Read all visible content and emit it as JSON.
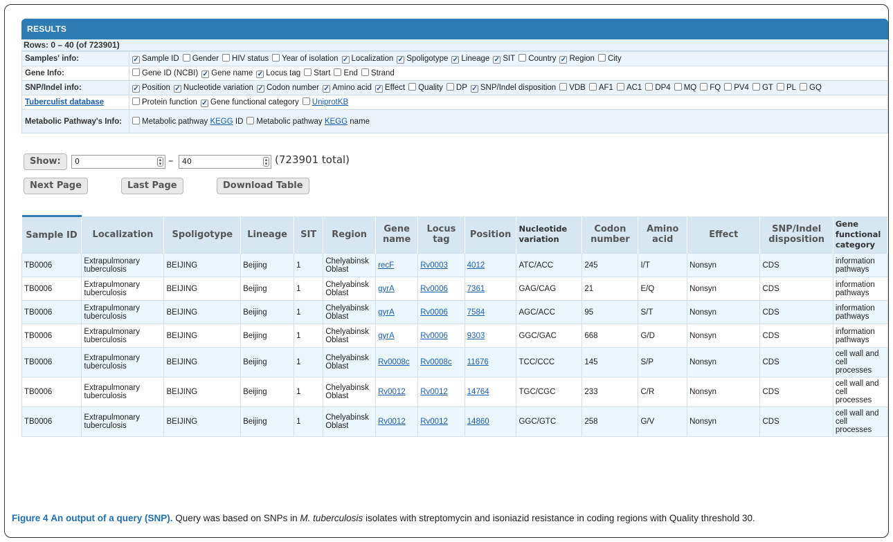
{
  "results_title": "RESULTS",
  "rows_info": "Rows: 0 – 40 (of 723901)",
  "info_rows": [
    {
      "label": "Samples' info:",
      "options": [
        {
          "text": "Sample ID",
          "checked": true
        },
        {
          "text": "Gender",
          "checked": false
        },
        {
          "text": "HIV status",
          "checked": false
        },
        {
          "text": "Year of isolation",
          "checked": false
        },
        {
          "text": "Localization",
          "checked": true
        },
        {
          "text": "Spoligotype",
          "checked": true
        },
        {
          "text": "Lineage",
          "checked": true
        },
        {
          "text": "SIT",
          "checked": true
        },
        {
          "text": "Country",
          "checked": false
        },
        {
          "text": "Region",
          "checked": true
        },
        {
          "text": "City",
          "checked": false
        }
      ]
    },
    {
      "label": "Gene Info:",
      "options": [
        {
          "text": "Gene ID (NCBI)",
          "checked": false
        },
        {
          "text": "Gene name",
          "checked": true
        },
        {
          "text": "Locus tag",
          "checked": true
        },
        {
          "text": "Start",
          "checked": false
        },
        {
          "text": "End",
          "checked": false
        },
        {
          "text": "Strand",
          "checked": false
        }
      ]
    },
    {
      "label": "SNP/Indel info:",
      "options": [
        {
          "text": "Position",
          "checked": true
        },
        {
          "text": "Nucleotide variation",
          "checked": true
        },
        {
          "text": "Codon number",
          "checked": true
        },
        {
          "text": "Amino acid",
          "checked": true
        },
        {
          "text": "Effect",
          "checked": true
        },
        {
          "text": "Quality",
          "checked": false
        },
        {
          "text": "DP",
          "checked": false
        },
        {
          "text": "SNP/Indel disposition",
          "checked": true
        },
        {
          "text": "VDB",
          "checked": false
        },
        {
          "text": "AF1",
          "checked": false
        },
        {
          "text": "AC1",
          "checked": false
        },
        {
          "text": "DP4",
          "checked": false
        },
        {
          "text": "MQ",
          "checked": false
        },
        {
          "text": "FQ",
          "checked": false
        },
        {
          "text": "PV4",
          "checked": false
        },
        {
          "text": "GT",
          "checked": false
        },
        {
          "text": "PL",
          "checked": false
        },
        {
          "text": "GQ",
          "checked": false
        }
      ]
    },
    {
      "label": "Tuberculist database",
      "label_link": true,
      "options": [
        {
          "text": "Protein function",
          "checked": false
        },
        {
          "text": "Gene functional category",
          "checked": true
        },
        {
          "text": "UniprotKB",
          "checked": false,
          "link": true
        }
      ]
    },
    {
      "label": "Metabolic Pathway's Info:",
      "options": [
        {
          "text": "Metabolic pathway",
          "link_text": "KEGG",
          "suffix": "ID",
          "checked": false
        },
        {
          "text": "Metabolic pathway",
          "link_text": "KEGG",
          "suffix": "name",
          "checked": false
        }
      ]
    }
  ],
  "controls": {
    "show_label": "Show:",
    "from_value": "0",
    "dash": "–",
    "to_value": "40",
    "total_text": "(723901 total)",
    "next_page": "Next Page",
    "last_page": "Last Page",
    "download_table": "Download Table"
  },
  "table": {
    "headers": [
      "Sample ID",
      "Localization",
      "Spoligotype",
      "Lineage",
      "SIT",
      "Region",
      "Gene name",
      "Locus tag",
      "Position",
      "Nucleotide variation",
      "Codon number",
      "Amino acid",
      "Effect",
      "SNP/Indel disposition",
      "Gene functional category"
    ],
    "rows": [
      [
        "TB0006",
        "Extrapulmonary tuberculosis",
        "BEIJING",
        "Beijing",
        "1",
        "Chelyabinsk Oblast",
        "recF",
        "Rv0003",
        "4012",
        "ATC/ACC",
        "245",
        "I/T",
        "Nonsyn",
        "CDS",
        "information pathways"
      ],
      [
        "TB0006",
        "Extrapulmonary tuberculosis",
        "BEIJING",
        "Beijing",
        "1",
        "Chelyabinsk Oblast",
        "gyrA",
        "Rv0006",
        "7361",
        "GAG/CAG",
        "21",
        "E/Q",
        "Nonsyn",
        "CDS",
        "information pathways"
      ],
      [
        "TB0006",
        "Extrapulmonary tuberculosis",
        "BEIJING",
        "Beijing",
        "1",
        "Chelyabinsk Oblast",
        "gyrA",
        "Rv0006",
        "7584",
        "AGC/ACC",
        "95",
        "S/T",
        "Nonsyn",
        "CDS",
        "information pathways"
      ],
      [
        "TB0006",
        "Extrapulmonary tuberculosis",
        "BEIJING",
        "Beijing",
        "1",
        "Chelyabinsk Oblast",
        "gyrA",
        "Rv0006",
        "9303",
        "GGC/GAC",
        "668",
        "G/D",
        "Nonsyn",
        "CDS",
        "information pathways"
      ],
      [
        "TB0006",
        "Extrapulmonary tuberculosis",
        "BEIJING",
        "Beijing",
        "1",
        "Chelyabinsk Oblast",
        "Rv0008c",
        "Rv0008c",
        "11676",
        "TCC/CCC",
        "145",
        "S/P",
        "Nonsyn",
        "CDS",
        "cell wall and cell processes"
      ],
      [
        "TB0006",
        "Extrapulmonary tuberculosis",
        "BEIJING",
        "Beijing",
        "1",
        "Chelyabinsk Oblast",
        "Rv0012",
        "Rv0012",
        "14764",
        "TGC/CGC",
        "233",
        "C/R",
        "Nonsyn",
        "CDS",
        "cell wall and cell processes"
      ],
      [
        "TB0006",
        "Extrapulmonary tuberculosis",
        "BEIJING",
        "Beijing",
        "1",
        "Chelyabinsk Oblast",
        "Rv0012",
        "Rv0012",
        "14860",
        "GGC/GTC",
        "258",
        "G/V",
        "Nonsyn",
        "CDS",
        "cell wall and cell processes"
      ]
    ]
  },
  "caption": {
    "figure_label": "Figure 4",
    "title": "An output of a query (SNP).",
    "text_before": "Query was based on SNPs in",
    "species": "M. tuberculosis",
    "text_after": "isolates with streptomycin and isoniazid resistance in coding regions with Quality threshold 30."
  },
  "colors": {
    "header_blue": "#2d7cb3",
    "row_tint": "#eaf6fb",
    "link": "#1a5fb4",
    "caption_blue": "#1f6fb2"
  }
}
